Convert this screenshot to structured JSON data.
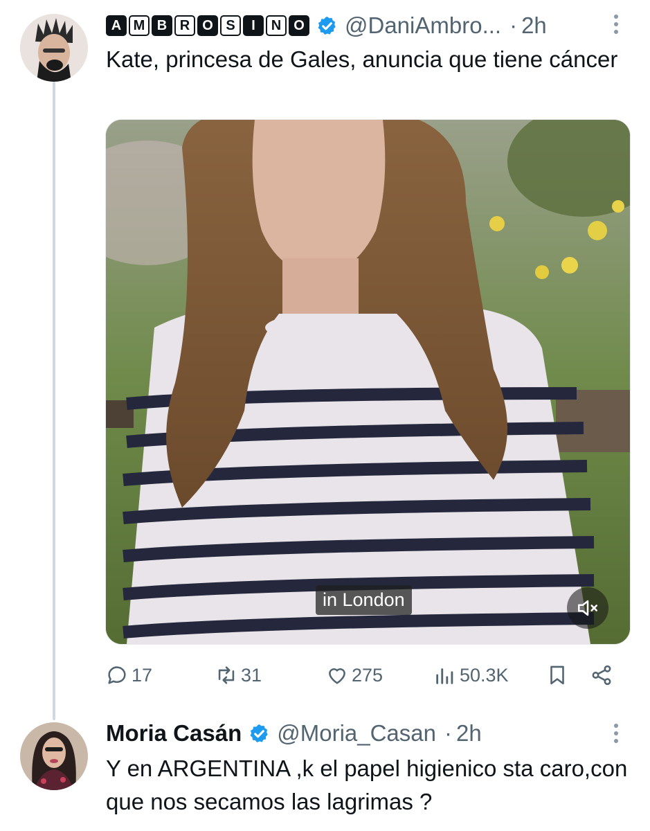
{
  "tweet1": {
    "display_name_letters": [
      "A",
      "M",
      "B",
      "R",
      "O",
      "S",
      "I",
      "N",
      "O"
    ],
    "handle": "@DaniAmbro...",
    "time": "2h",
    "text": "Kate, princesa de Gales, anuncia que tiene cáncer",
    "media": {
      "caption": "in London",
      "mute_icon": "volume-mute-icon"
    },
    "actions": {
      "replies": "17",
      "reposts": "31",
      "likes": "275",
      "views": "50.3K"
    }
  },
  "tweet2": {
    "display_name": "Moria Casán",
    "handle": "@Moria_Casan",
    "time": "2h",
    "text": "Y en ARGENTINA ,k el papel higienico sta caro,con que nos secamos las lagrimas ?"
  },
  "colors": {
    "verified": "#1d9bf0",
    "muted_text": "#536471",
    "thread_line": "#cfd9de"
  },
  "icons": [
    "verified-badge-icon",
    "reply-icon",
    "repost-icon",
    "like-icon",
    "views-icon",
    "bookmark-icon",
    "share-icon",
    "more-icon"
  ]
}
